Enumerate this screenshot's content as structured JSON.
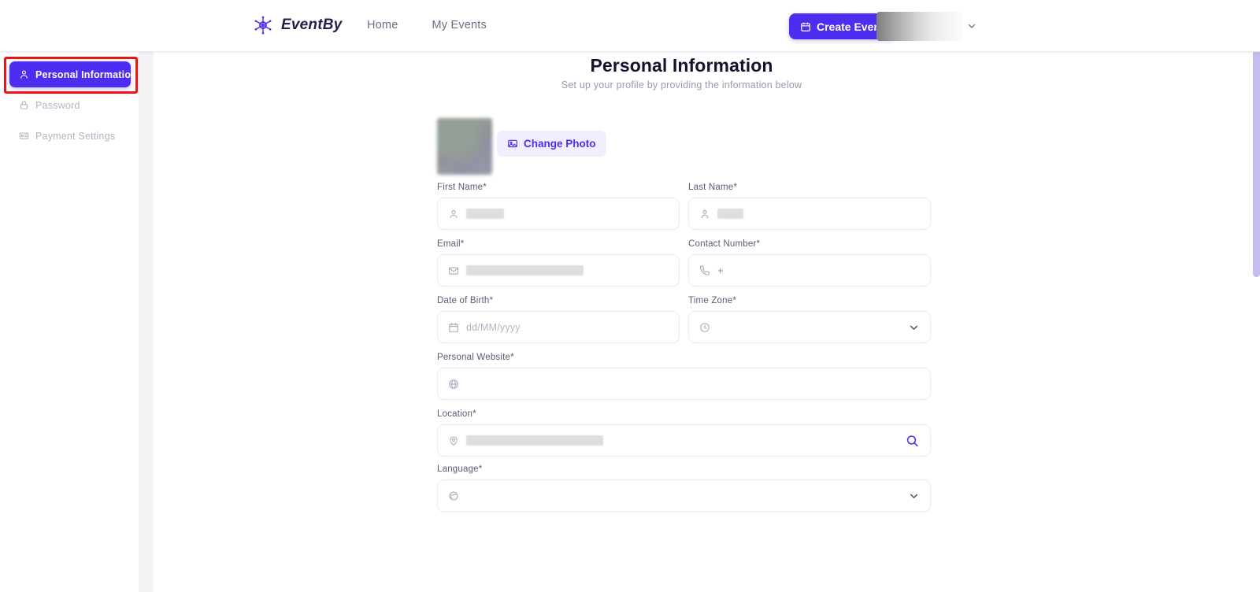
{
  "header": {
    "brand_name": "EventBy",
    "logo_icon": "snowflake-logo-icon",
    "nav": [
      {
        "label": "Home",
        "name": "nav-home"
      },
      {
        "label": "My Events",
        "name": "nav-my-events"
      }
    ],
    "create_event_label": "Create Event",
    "create_event_icon": "calendar-icon",
    "user_menu_caret_icon": "chevron-down-icon",
    "accent_color": "#4b2ef0"
  },
  "sidebar": {
    "items": [
      {
        "label": "Personal Information",
        "icon": "user-icon",
        "active": true
      },
      {
        "label": "Password",
        "icon": "lock-icon",
        "active": false
      },
      {
        "label": "Payment Settings",
        "icon": "credit-card-icon",
        "active": false
      }
    ]
  },
  "annotation": {
    "color": "#ee1212",
    "target": "sidebar-item-personal-information"
  },
  "main": {
    "title": "Personal Information",
    "subtitle": "Set up your profile by providing the information below",
    "avatar": {
      "name": "profile-photo",
      "state": "blurred"
    },
    "change_photo_label": "Change Photo",
    "change_photo_icon": "image-upload-icon",
    "fields": [
      {
        "id": "first-name",
        "label": "First Name*",
        "icon": "user-icon",
        "placeholder": "",
        "value": "",
        "redacted": true,
        "redact_width": 48,
        "control": "text",
        "column": "left",
        "row": 1
      },
      {
        "id": "last-name",
        "label": "Last Name*",
        "icon": "user-icon",
        "placeholder": "",
        "value": "",
        "redacted": true,
        "redact_width": 33,
        "control": "text",
        "column": "right",
        "row": 1
      },
      {
        "id": "email",
        "label": "Email*",
        "icon": "mail-icon",
        "placeholder": "",
        "value": "",
        "redacted": true,
        "redact_width": 149,
        "control": "text",
        "column": "left",
        "row": 2
      },
      {
        "id": "contact-number",
        "label": "Contact Number*",
        "icon": "phone-icon",
        "prefix": "+",
        "placeholder": "",
        "value": "",
        "redacted": false,
        "control": "tel",
        "column": "right",
        "row": 2
      },
      {
        "id": "date-of-birth",
        "label": "Date of Birth*",
        "icon": "calendar-icon",
        "placeholder": "dd/MM/yyyy",
        "value": "",
        "redacted": false,
        "control": "date",
        "column": "left",
        "row": 3
      },
      {
        "id": "time-zone",
        "label": "Time Zone*",
        "icon": "clock-icon",
        "placeholder": "",
        "value": "",
        "redacted": false,
        "control": "select",
        "trailing_icon": "chevron-down-icon",
        "column": "right",
        "row": 3
      },
      {
        "id": "personal-website",
        "label": "Personal Website*",
        "icon": "globe-icon",
        "placeholder": "",
        "value": "",
        "redacted": false,
        "control": "url",
        "column": "full",
        "row": 4
      },
      {
        "id": "location",
        "label": "Location*",
        "icon": "map-pin-icon",
        "placeholder": "",
        "value": "",
        "redacted": true,
        "redact_width": 174,
        "control": "text",
        "trailing_icon": "search-icon",
        "column": "full",
        "row": 5
      },
      {
        "id": "language",
        "label": "Language*",
        "icon": "language-globe-icon",
        "placeholder": "",
        "value": "",
        "redacted": false,
        "control": "select",
        "trailing_icon": "chevron-down-icon",
        "column": "full",
        "row": 6
      }
    ]
  },
  "scrollbar": {
    "color": "#c3bdf2"
  }
}
